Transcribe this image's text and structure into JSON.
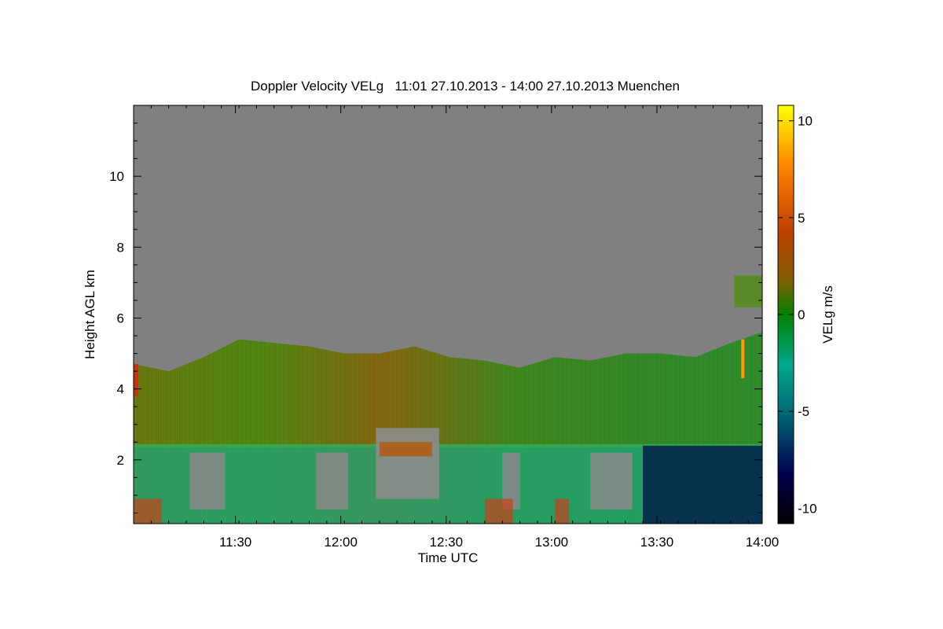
{
  "chart_data": {
    "type": "heatmap",
    "title": "Doppler Velocity VELg   11:01 27.10.2013 - 14:00 27.10.2013 Muenchen",
    "xlabel": "Time UTC",
    "ylabel": "Height AGL km",
    "x_range": [
      "11:01",
      "14:00"
    ],
    "x_ticks": [
      "11:30",
      "12:00",
      "12:30",
      "13:00",
      "13:30",
      "14:00"
    ],
    "x_tick_minutes": [
      29,
      59,
      89,
      119,
      149,
      179
    ],
    "y_range": [
      0.2,
      12.0
    ],
    "y_ticks": [
      2,
      4,
      6,
      8,
      10
    ],
    "colorbar": {
      "label": "VELg m/s",
      "range": [
        -10.8,
        10.8
      ],
      "ticks": [
        10,
        5,
        0,
        -5,
        -10
      ],
      "colors": [
        "#000000",
        "#000050",
        "#005f73",
        "#00a98c",
        "#008000",
        "#806000",
        "#c04000",
        "#ff8000",
        "#ffff00"
      ]
    },
    "no_signal_color": "#808080",
    "layers": [
      {
        "name": "cloud_echo_top_km",
        "time_min": [
          0,
          10,
          20,
          30,
          40,
          50,
          60,
          70,
          80,
          90,
          100,
          110,
          120,
          130,
          140,
          150,
          160,
          170,
          179
        ],
        "values": [
          4.7,
          4.5,
          4.9,
          5.4,
          5.3,
          5.2,
          5.0,
          5.0,
          5.2,
          4.9,
          4.8,
          4.6,
          4.9,
          4.8,
          5.0,
          5.0,
          4.9,
          5.3,
          5.6
        ]
      },
      {
        "name": "boundary_layer_top_km",
        "values_km": 2.4
      },
      {
        "name": "strong_downdraft_zone",
        "time_min": [
          145,
          179
        ],
        "height_km": [
          0.2,
          2.4
        ],
        "velocity_ms": -9
      },
      {
        "name": "upper_echo_patch",
        "time_min": [
          171,
          179
        ],
        "height_km": [
          6.3,
          7.2
        ],
        "velocity_ms": -1
      }
    ]
  }
}
